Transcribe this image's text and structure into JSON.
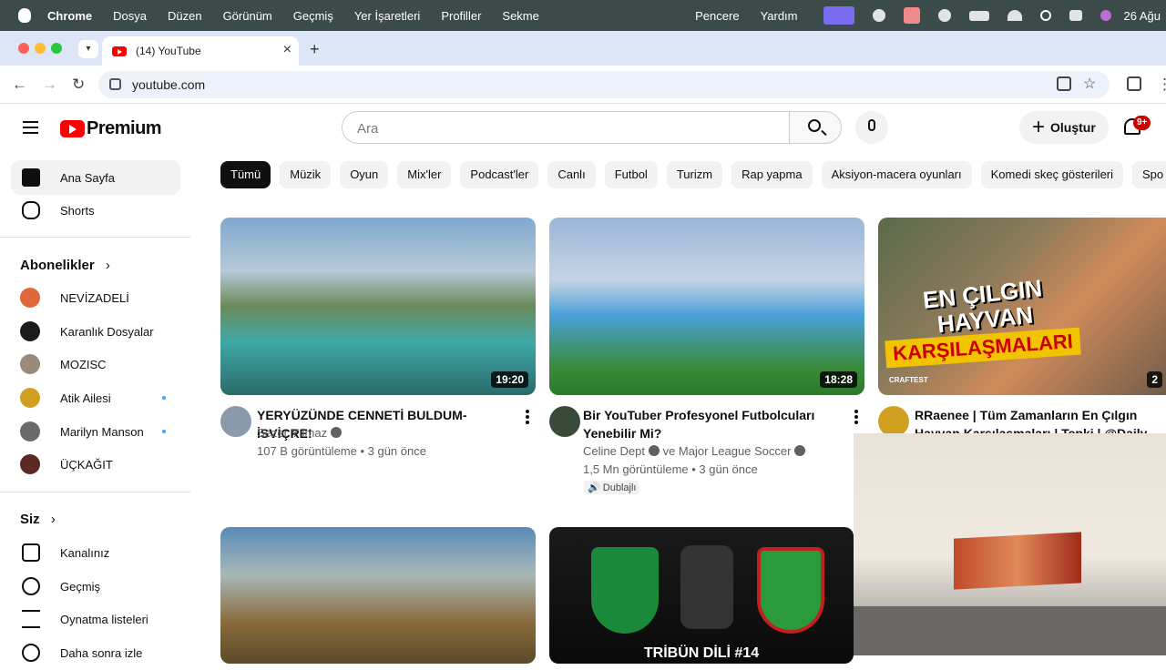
{
  "menubar": {
    "app": "Chrome",
    "items": [
      "Dosya",
      "Düzen",
      "Görünüm",
      "Geçmiş",
      "Yer İşaretleri",
      "Profiller",
      "Sekme"
    ],
    "right_items": [
      "Pencere",
      "Yardım"
    ],
    "date": "26 Ağu"
  },
  "browser": {
    "tab_title": "(14) YouTube",
    "url": "youtube.com"
  },
  "yt": {
    "logo_text": "Premium",
    "search_placeholder": "Ara",
    "create_label": "Oluştur",
    "notifications_badge": "9+"
  },
  "sidebar": {
    "main": [
      {
        "label": "Ana Sayfa",
        "icon": "home-icon"
      },
      {
        "label": "Shorts",
        "icon": "shorts-icon"
      }
    ],
    "subscriptions_title": "Abonelikler",
    "subscriptions": [
      {
        "label": "NEVİZADELİ",
        "dot": false
      },
      {
        "label": "Karanlık Dosyalar",
        "dot": false
      },
      {
        "label": "MOZISC",
        "dot": false
      },
      {
        "label": "Atik Ailesi",
        "dot": true
      },
      {
        "label": "Marilyn Manson",
        "dot": true
      },
      {
        "label": "ÜÇKAĞIT",
        "dot": false
      }
    ],
    "you_title": "Siz",
    "you": [
      {
        "label": "Kanalınız",
        "icon": "channel-icon"
      },
      {
        "label": "Geçmiş",
        "icon": "history-icon"
      },
      {
        "label": "Oynatma listeleri",
        "icon": "playlists-icon"
      },
      {
        "label": "Daha sonra izle",
        "icon": "watch-later-icon"
      }
    ]
  },
  "chips": [
    "Tümü",
    "Müzik",
    "Oyun",
    "Mix'ler",
    "Podcast'ler",
    "Canlı",
    "Futbol",
    "Turizm",
    "Rap yapma",
    "Aksiyon-macera oyunları",
    "Komedi skeç gösterileri",
    "Spo"
  ],
  "videos": [
    {
      "title": "YERYÜZÜNDE CENNETİ BULDUM- İSVİÇRE!",
      "channel": "Sezer Yılmaz",
      "stats": "107 B görüntüleme • 3 gün önce",
      "duration": "19:20"
    },
    {
      "title_line1": "Bir YouTuber Profesyonel Futbolcuları",
      "title_line2": "Yenebilir Mi?",
      "channel": "Celine Dept",
      "channel_extra": "ve Major League Soccer",
      "stats": "1,5 Mn görüntüleme • 3 gün önce",
      "badge": "Dublajlı",
      "duration": "18:28"
    },
    {
      "title_line1": "RRaenee | Tüm Zamanların En Çılgın",
      "title_line2": "Hayvan Karşılaşmaları | Tepki | @Daily...",
      "thumb_text1": "EN ÇILGIN",
      "thumb_text2": "HAYVAN",
      "thumb_text3": "KARŞILAŞMALARI",
      "thumb_tag": "CRAFTEST",
      "duration_partial": "2"
    },
    {
      "thumb_caption": "TRİBÜN DİLİ #14"
    }
  ]
}
